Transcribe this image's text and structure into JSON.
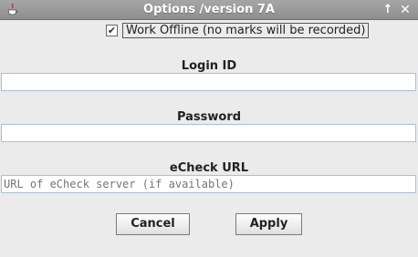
{
  "window": {
    "title": "Options /version 7A",
    "maximize_glyph": "↑",
    "close_glyph": "✕"
  },
  "offline": {
    "checked": true,
    "check_glyph": "✔",
    "label": "Work Offline (no marks will be recorded)"
  },
  "login": {
    "label": "Login ID",
    "value": ""
  },
  "password": {
    "label": "Password",
    "value": ""
  },
  "echeck": {
    "label": "eCheck URL",
    "placeholder": "URL of eCheck server (if available)",
    "value": ""
  },
  "buttons": {
    "cancel": "Cancel",
    "apply": "Apply"
  },
  "colors": {
    "titlebar": "#999999",
    "field_border": "#a8c0d8",
    "placeholder": "#a8b4c4"
  }
}
